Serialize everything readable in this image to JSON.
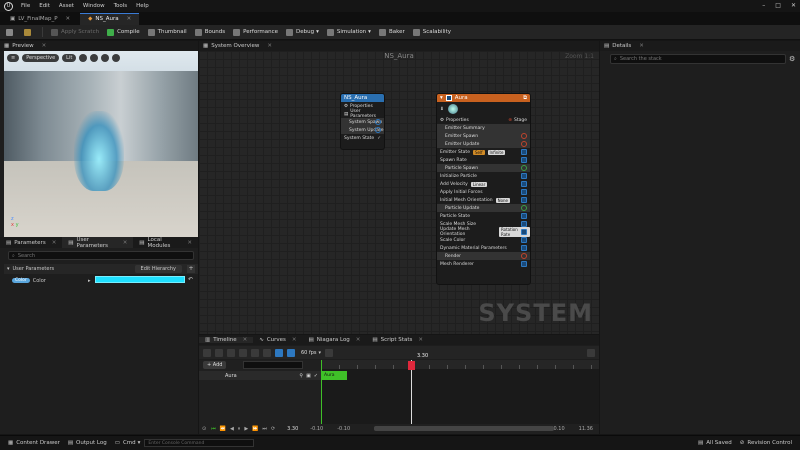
{
  "menu": {
    "logo": "U",
    "items": [
      "File",
      "Edit",
      "Asset",
      "Window",
      "Tools",
      "Help"
    ]
  },
  "window_controls": {
    "minimize": "–",
    "maximize": "□",
    "close": "✕"
  },
  "tabs": [
    {
      "label": "LV_FinalMap_P",
      "close": "✕"
    },
    {
      "label": "NS_Aura",
      "close": "✕"
    }
  ],
  "toolbar": {
    "apply_scratch": "Apply Scratch",
    "compile": "Compile",
    "thumbnail": "Thumbnail",
    "bounds": "Bounds",
    "performance": "Performance",
    "debug": "Debug",
    "simulation": "Simulation",
    "baker": "Baker",
    "scalability": "Scalability"
  },
  "preview": {
    "tab": "Preview",
    "perspective": "Perspective",
    "lit": "Lit"
  },
  "left_tabs": {
    "parameters": "Parameters",
    "user_parameters": "User Parameters",
    "local_modules": "Local Modules"
  },
  "left_panel": {
    "search_placeholder": "Search",
    "section": "User Parameters",
    "edit_hierarchy": "Edit Hierarchy",
    "add": "+",
    "color_type": "Color",
    "color_label": "Color",
    "color_value": "#1fe0ff"
  },
  "system_overview": {
    "tab": "System Overview",
    "title": "NS_Aura",
    "zoom": "Zoom 1:1",
    "watermark": "SYSTEM"
  },
  "system_node": {
    "title": "NS_Aura",
    "rows": [
      "Properties",
      "User Parameters",
      "System Spawn",
      "System Update",
      "System State"
    ]
  },
  "emitter_node": {
    "title": "Aura",
    "properties": "Properties",
    "stage": "Stage",
    "rows": [
      {
        "label": "Emitter Summary",
        "kind": "sect"
      },
      {
        "label": "Emitter Spawn",
        "kind": "sect-red"
      },
      {
        "label": "Emitter Update",
        "kind": "sect-red"
      },
      {
        "label": "Emitter State",
        "tag": "Self",
        "tag2": "Infinite",
        "kind": "row"
      },
      {
        "label": "Spawn Rate",
        "kind": "row"
      },
      {
        "label": "Particle Spawn",
        "kind": "sect-green"
      },
      {
        "label": "Initialize Particle",
        "kind": "row"
      },
      {
        "label": "Add Velocity",
        "tag": "Linear",
        "kind": "row"
      },
      {
        "label": "Apply Initial Forces",
        "kind": "row"
      },
      {
        "label": "Initial Mesh Orientation",
        "tag": "None",
        "kind": "row"
      },
      {
        "label": "Particle Update",
        "kind": "sect-green"
      },
      {
        "label": "Particle State",
        "kind": "row"
      },
      {
        "label": "Scale Mesh Size",
        "kind": "row"
      },
      {
        "label": "Update Mesh Orientation",
        "tag": "Rotation Rate",
        "kind": "row"
      },
      {
        "label": "Scale Color",
        "kind": "row"
      },
      {
        "label": "Dynamic Material Parameters",
        "kind": "row"
      },
      {
        "label": "Render",
        "kind": "sect-red"
      },
      {
        "label": "Mesh Renderer",
        "kind": "row"
      }
    ]
  },
  "details": {
    "tab": "Details",
    "search_placeholder": "Search the stack"
  },
  "timeline": {
    "tabs": {
      "timeline": "Timeline",
      "curves": "Curves",
      "niagara_log": "Niagara Log",
      "script_stats": "Script Stats"
    },
    "fps": "60 fps",
    "add": "+ Add",
    "track": "Aura",
    "bar_label": "Aura",
    "playhead": "3.30",
    "current_time": "3.30",
    "range_start_a": "-0.10",
    "range_start_b": "-0.10",
    "range_end_a": "10.10",
    "range_end_b": "11.36"
  },
  "status": {
    "content_drawer": "Content Drawer",
    "output_log": "Output Log",
    "cmd": "Cmd",
    "cmd_placeholder": "Enter Console Command",
    "all_saved": "All Saved",
    "revision_control": "Revision Control"
  }
}
